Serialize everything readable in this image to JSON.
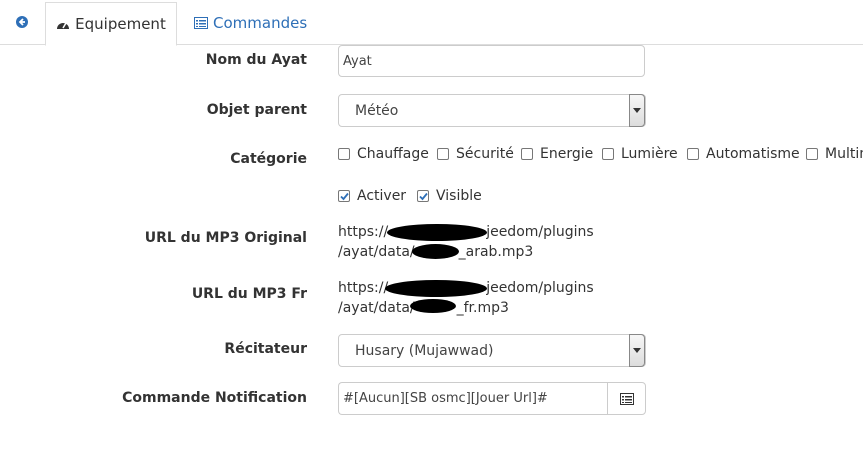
{
  "tabs": {
    "back_icon": "arrow-left-circle-icon",
    "equipement_label": "Equipement",
    "commandes_label": "Commandes"
  },
  "form": {
    "nom_label": "Nom du Ayat",
    "nom_value": "Ayat",
    "objet_label": "Objet parent",
    "objet_value": "Météo",
    "categorie_label": "Catégorie",
    "categories": [
      "Chauffage",
      "Sécurité",
      "Energie",
      "Lumière",
      "Automatisme",
      "Multim"
    ],
    "activer_label": "Activer",
    "activer_checked": true,
    "visible_label": "Visible",
    "visible_checked": true,
    "url_original_label": "URL du MP3 Original",
    "url_original_line1_a": "https://",
    "url_original_line1_b": "jeedom/plugins",
    "url_original_line2_a": "/ayat/data/",
    "url_original_line2_b": "_arab.mp3",
    "url_fr_label": "URL du MP3 Fr",
    "url_fr_line1_a": "https://",
    "url_fr_line1_b": "jeedom/plugins",
    "url_fr_line2_a": "/ayat/data/",
    "url_fr_line2_b": "_fr.mp3",
    "recitateur_label": "Récitateur",
    "recitateur_value": "Husary (Mujawwad)",
    "commande_label": "Commande Notification",
    "commande_value": "#[Aucun][SB osmc][Jouer Url]#"
  },
  "colors": {
    "link": "#2e6fb7",
    "border": "#cccccc"
  }
}
